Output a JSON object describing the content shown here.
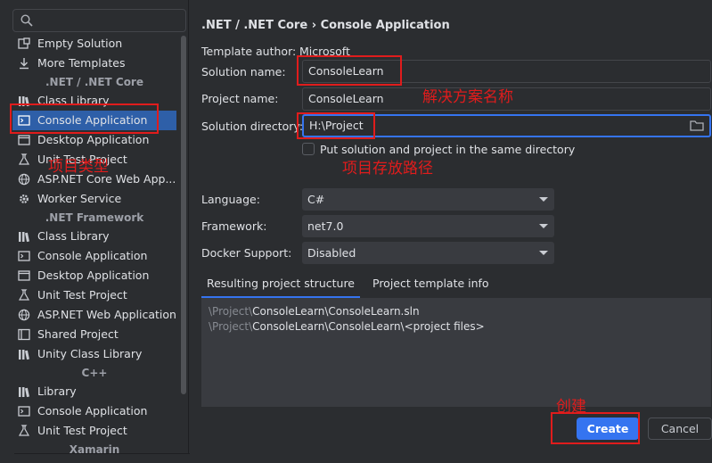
{
  "search": {
    "placeholder": ""
  },
  "sidebar": {
    "items": [
      {
        "label": "Empty Solution",
        "icon": "solution-icon"
      },
      {
        "label": "More Templates",
        "icon": "download-icon"
      },
      {
        "group": ".NET / .NET Core"
      },
      {
        "label": "Class Library",
        "icon": "library-icon"
      },
      {
        "label": "Console Application",
        "icon": "console-icon",
        "selected": true
      },
      {
        "label": "Desktop Application",
        "icon": "window-icon"
      },
      {
        "label": "Unit Test Project",
        "icon": "flask-icon"
      },
      {
        "label": "ASP.NET Core Web App...",
        "icon": "globe-icon"
      },
      {
        "label": "Worker Service",
        "icon": "gear-icon"
      },
      {
        "group": ".NET Framework"
      },
      {
        "label": "Class Library",
        "icon": "library-icon"
      },
      {
        "label": "Console Application",
        "icon": "console-icon"
      },
      {
        "label": "Desktop Application",
        "icon": "window-icon"
      },
      {
        "label": "Unit Test Project",
        "icon": "flask-icon"
      },
      {
        "label": "ASP.NET Web Application",
        "icon": "globe-icon"
      },
      {
        "label": "Shared Project",
        "icon": "shared-icon"
      },
      {
        "label": "Unity Class Library",
        "icon": "library-icon"
      },
      {
        "group": "C++"
      },
      {
        "label": "Library",
        "icon": "library-icon"
      },
      {
        "label": "Console Application",
        "icon": "console-icon"
      },
      {
        "label": "Unit Test Project",
        "icon": "flask-icon"
      },
      {
        "group": "Xamarin"
      }
    ]
  },
  "header": {
    "breadcrumb_prefix": ".NET / .NET Core",
    "separator": "›",
    "breadcrumb_current": "Console Application"
  },
  "form": {
    "template_author_label": "Template author:",
    "template_author_value": "Microsoft",
    "solution_name_label": "Solution name:",
    "solution_name_value": "ConsoleLearn",
    "project_name_label": "Project name:",
    "project_name_value": "ConsoleLearn",
    "solution_directory_label": "Solution directory:",
    "solution_directory_value": "H:\\Project",
    "same_directory_label": "Put solution and project in the same directory",
    "same_directory_checked": false,
    "language_label": "Language:",
    "language_value": "C#",
    "framework_label": "Framework:",
    "framework_value": "net7.0",
    "docker_label": "Docker Support:",
    "docker_value": "Disabled"
  },
  "tabs": [
    {
      "label": "Resulting project structure",
      "active": true
    },
    {
      "label": "Project template info",
      "active": false
    }
  ],
  "structure": {
    "line1_dim": "\\Project\\",
    "line1_rest": "ConsoleLearn\\ConsoleLearn.sln",
    "line2_dim": "\\Project\\",
    "line2_rest": "ConsoleLearn\\ConsoleLearn\\<project files>"
  },
  "buttons": {
    "create": "Create",
    "cancel": "Cancel"
  },
  "annotations": {
    "solution_name_note": "解决方案名称",
    "directory_note": "项目存放路径",
    "project_type_note": "项目类型",
    "create_note": "创建"
  },
  "colors": {
    "accent": "#3574f0",
    "annotation": "#e01c1c",
    "background": "#2b2d30"
  }
}
